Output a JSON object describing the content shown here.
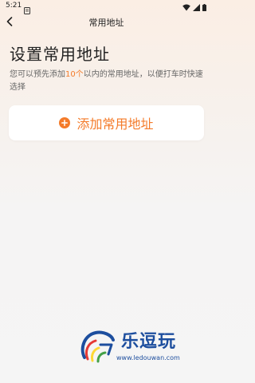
{
  "status_bar": {
    "time": "5:21"
  },
  "nav": {
    "title": "常用地址"
  },
  "page": {
    "heading": "设置常用地址",
    "desc_prefix": "您可以预先添加",
    "desc_count": "10个",
    "desc_suffix": "以内的常用地址，以便打车时快速选择"
  },
  "add_button": {
    "label": "添加常用地址"
  },
  "watermark": {
    "brand": "乐逗玩",
    "url": "www.ledouwan.com"
  },
  "colors": {
    "accent": "#f47b2a",
    "brand_blue": "#1d4e9e"
  }
}
